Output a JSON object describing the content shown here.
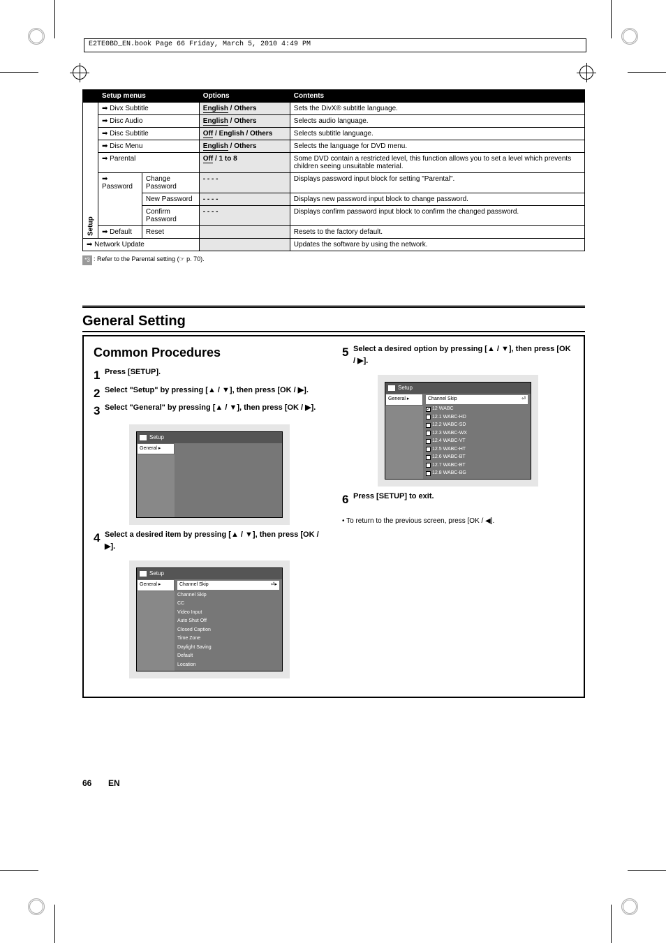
{
  "print_header": "E2TE0BD_EN.book  Page 66  Friday, March 5, 2010  4:49 PM",
  "table_header": {
    "c1": "",
    "c2": "Setup menus",
    "c3": "Options",
    "c4": "Contents"
  },
  "rows": [
    {
      "group": "Setup",
      "label": "Divx Subtitle",
      "arrow": "➡",
      "options": [
        "English",
        "Others"
      ],
      "under": "English",
      "desc": "Sets the DivX® subtitle language."
    },
    {
      "group": "Setup",
      "label": "Disc Audio",
      "arrow": "➡",
      "options": [
        "English",
        "Others"
      ],
      "under": "English",
      "desc": "Selects audio language."
    },
    {
      "group": "Setup",
      "label": "Disc Subtitle",
      "arrow": "➡",
      "options": [
        "Off",
        "English",
        "Others"
      ],
      "under": "Off",
      "desc": "Selects subtitle language."
    },
    {
      "group": "Setup",
      "label": "Disc Menu",
      "arrow": "➡",
      "options": [
        "English",
        "Others"
      ],
      "under": "English",
      "desc": "Selects the language for DVD menu."
    },
    {
      "group": "Setup",
      "label": "Parental",
      "arrow": "➡",
      "sub": "",
      "options": [
        "Off",
        "1 to 8"
      ],
      "under": "Off",
      "desc": "Some DVD contain a restricted level, this function allows you to set a level which prevents children seeing unsuitable material."
    },
    {
      "group": "Setup",
      "label": "Password",
      "arrow": "➡",
      "sub": "Change Password",
      "options": [
        "- - - -"
      ],
      "under": "",
      "desc": "Displays password input block for setting \"Parental\"."
    },
    {
      "group": "Setup",
      "label": "",
      "arrow": "",
      "sub": "New Password",
      "options": [
        "- - - -"
      ],
      "under": "",
      "desc": "Displays new password input block to change password."
    },
    {
      "group": "Setup",
      "label": "",
      "arrow": "",
      "sub": "Confirm Password",
      "options": [
        "- - - -"
      ],
      "under": "",
      "desc": "Displays confirm password input block to confirm the changed password."
    },
    {
      "group": "Setup",
      "label": "Default",
      "arrow": "➡",
      "sub": "Reset",
      "options": [
        ""
      ],
      "under": "",
      "desc": "Resets to the factory default."
    },
    {
      "group": "",
      "label": "Network Update",
      "arrow": "➡",
      "sub": "",
      "options": [
        ""
      ],
      "under": "",
      "desc": "Updates the software by using the network."
    }
  ],
  "note": {
    "tag": "*3",
    "text": ": Refer to the Parental setting (☞ p. 70)."
  },
  "section_title": "General Setting",
  "common_title": "Common Procedures",
  "steps_left": [
    {
      "n": "1",
      "html": "Press {b}[SETUP]{/b}."
    },
    {
      "n": "2",
      "html": "Select \"Setup\" by pressing [{tri}], then press [OK {sep} {rt}]."
    },
    {
      "n": "3",
      "html": "Select \"General\" by pressing [{tri}], then press [OK {sep} {rt}]."
    },
    {
      "n": "4",
      "html": "Select a desired item by pressing [{tri}], then press [OK {sep} {rt}]."
    }
  ],
  "steps_right": [
    {
      "n": "5",
      "html": "Select a desired option by pressing [{tri}], then press [OK {sep} {rt}]."
    },
    {
      "n": "6",
      "html": "Press {b}[SETUP]{/b} to exit."
    }
  ],
  "right_note": "• To return to the previous screen, press [OK / ◀].",
  "osd1": {
    "title": "Setup",
    "side": "General",
    "main_items": []
  },
  "osd2": {
    "title": "Setup",
    "side": "General",
    "panel": "Channel Skip",
    "sub_items": [
      "Channel Skip",
      "CC",
      "Video Input",
      "Auto Shut Off",
      "Closed Caption",
      "Time Zone",
      "Daylight Saving",
      "Default",
      "Location"
    ]
  },
  "osd3": {
    "title": "Setup",
    "side": "General",
    "panel": "Channel Skip",
    "channels": [
      {
        "n": "12",
        "name": "WABC",
        "chk": true
      },
      {
        "n": "12.1",
        "name": "WABC-HD",
        "chk": false
      },
      {
        "n": "12.2",
        "name": "WABC-SD",
        "chk": false
      },
      {
        "n": "12.3",
        "name": "WABC-WX",
        "chk": false
      },
      {
        "n": "12.4",
        "name": "WABC-VT",
        "chk": false
      },
      {
        "n": "12.5",
        "name": "WABC-HT",
        "chk": false
      },
      {
        "n": "12.6",
        "name": "WABC-BT",
        "chk": false
      },
      {
        "n": "12.7",
        "name": "WABC-BT",
        "chk": false
      },
      {
        "n": "12.8",
        "name": "WABC-BG",
        "chk": false
      }
    ]
  },
  "page_num": "66",
  "page_label": "EN"
}
